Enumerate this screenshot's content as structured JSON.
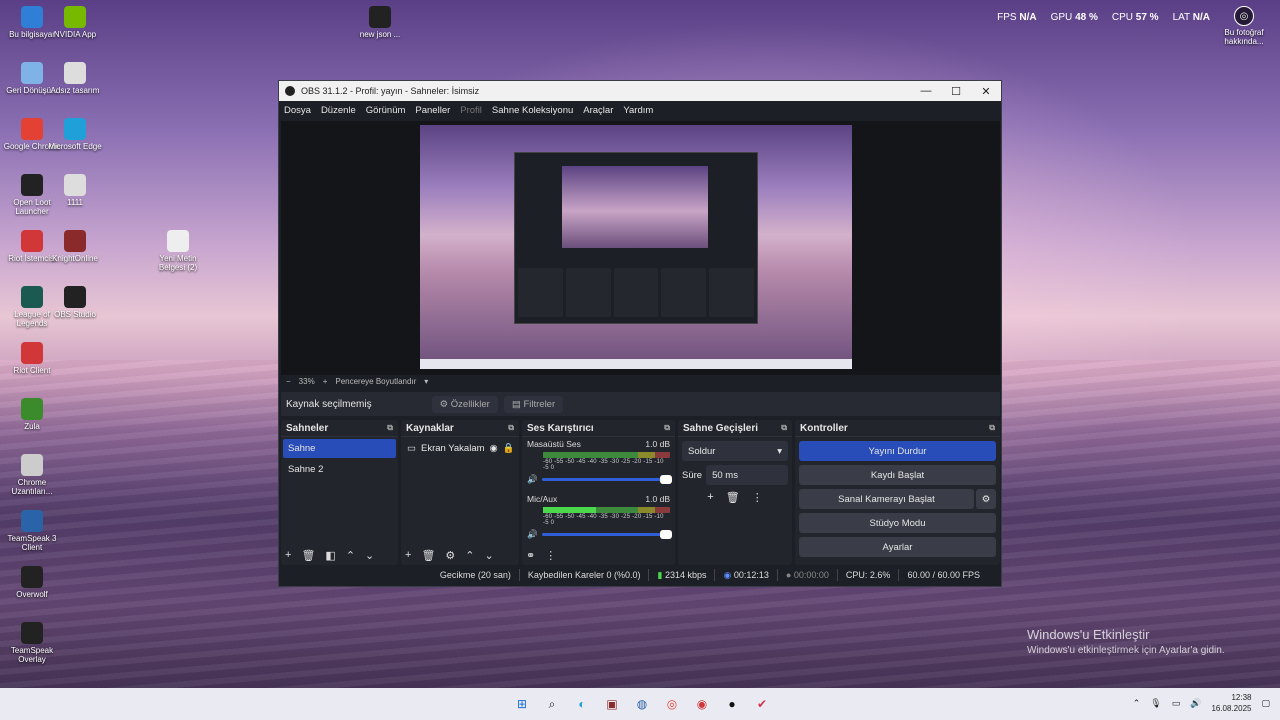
{
  "desktop": {
    "icons": [
      {
        "label": "Bu bilgisayar",
        "icon": "computer-icon",
        "color": "#2f7fd6"
      },
      {
        "label": "NVIDIA App",
        "icon": "nvidia-icon",
        "color": "#76b900"
      },
      {
        "label": "Geri Dönüşü...",
        "icon": "recycle-bin-icon",
        "color": "#7fb3e8"
      },
      {
        "label": "Adsız tasarım",
        "icon": "image-file-icon",
        "color": "#ddd"
      },
      {
        "label": "Google Chrome",
        "icon": "chrome-icon",
        "color": "#e34133"
      },
      {
        "label": "Microsoft Edge",
        "icon": "edge-icon",
        "color": "#1fa0d8"
      },
      {
        "label": "Open Loot Launcher",
        "icon": "open-loot-icon",
        "color": "#222"
      },
      {
        "label": "1111",
        "icon": "file-icon",
        "color": "#ddd"
      },
      {
        "label": "Riot İstemcisi",
        "icon": "riot-icon",
        "color": "#d13639"
      },
      {
        "label": "KnightOnline",
        "icon": "knight-online-icon",
        "color": "#8a2a2a"
      },
      {
        "label": "Yeni Metin Belgesi (2)",
        "icon": "text-file-icon",
        "color": "#eee"
      },
      {
        "label": "League of Legends",
        "icon": "league-icon",
        "color": "#1a5a50"
      },
      {
        "label": "OBS Studio",
        "icon": "obs-icon",
        "color": "#222"
      },
      {
        "label": "Riot Client",
        "icon": "riot-icon",
        "color": "#d13639"
      },
      {
        "label": "Zula",
        "icon": "zula-icon",
        "color": "#3b8a2b"
      },
      {
        "label": "Chrome Uzantıları...",
        "icon": "chrome-extensions-icon",
        "color": "#ccc"
      },
      {
        "label": "TeamSpeak 3 Client",
        "icon": "teamspeak-icon",
        "color": "#2a63a8"
      },
      {
        "label": "Overwolf",
        "icon": "overwolf-icon",
        "color": "#222"
      },
      {
        "label": "TeamSpeak Overlay",
        "icon": "teamspeak-icon",
        "color": "#222"
      },
      {
        "label": "new json ...",
        "icon": "obs-icon",
        "color": "#222"
      }
    ],
    "stats": {
      "fps_label": "FPS",
      "fps_value": "N/A",
      "gpu_label": "GPU",
      "gpu_value": "48 %",
      "cpu_label": "CPU",
      "cpu_value": "57 %",
      "lat_label": "LAT",
      "lat_value": "N/A"
    },
    "photo_info": "Bu fotoğraf hakkında...",
    "activation_title": "Windows'u Etkinleştir",
    "activation_sub": "Windows'u etkinleştirmek için Ayarlar'a gidin."
  },
  "taskbar": {
    "time": "12:38",
    "date": "16.08.2025"
  },
  "obs": {
    "title": "OBS 31.1.2 - Profil: yayın - Sahneler: İsimsiz",
    "menu": [
      "Dosya",
      "Düzenle",
      "Görünüm",
      "Paneller",
      "Profil",
      "Sahne Koleksiyonu",
      "Araçlar",
      "Yardım"
    ],
    "zoom_minus": "−",
    "zoom_value": "33%",
    "zoom_plus": "+",
    "zoom_mode": "Pencereye Boyutlandır",
    "no_source": "Kaynak seçilmemiş",
    "properties": "Özellikler",
    "filters": "Filtreler",
    "scenes": {
      "title": "Sahneler",
      "items": [
        "Sahne",
        "Sahne 2"
      ]
    },
    "sources": {
      "title": "Kaynaklar",
      "items": [
        "Ekran Yakalam"
      ]
    },
    "mixer": {
      "title": "Ses Karıştırıcı",
      "ticks": "-60 -55 -50 -45 -40 -35 -30 -25 -20 -15 -10 -5 0",
      "channels": [
        {
          "name": "Masaüstü Ses",
          "db": "1.0 dB",
          "level": 0
        },
        {
          "name": "Mic/Aux",
          "db": "1.0 dB",
          "level": 0.42
        }
      ]
    },
    "transitions": {
      "title": "Sahne Geçişleri",
      "type": "Soldur",
      "duration_label": "Süre",
      "duration": "50 ms"
    },
    "controls": {
      "title": "Kontroller",
      "stop_stream": "Yayını Durdur",
      "start_record": "Kaydı Başlat",
      "start_vcam": "Sanal Kamerayı Başlat",
      "studio_mode": "Stüdyo Modu",
      "settings": "Ayarlar"
    },
    "status": {
      "delay": "Gecikme (20 san)",
      "dropped": "Kaybedilen Kareler 0 (%0.0)",
      "bitrate": "2314 kbps",
      "stream_time": "00:12:13",
      "rec_time": "00:00:00",
      "cpu": "CPU: 2.6%",
      "fps": "60.00 / 60.00 FPS"
    },
    "colors": {
      "accent": "#284cb8",
      "bg": "#1d1f26"
    }
  }
}
